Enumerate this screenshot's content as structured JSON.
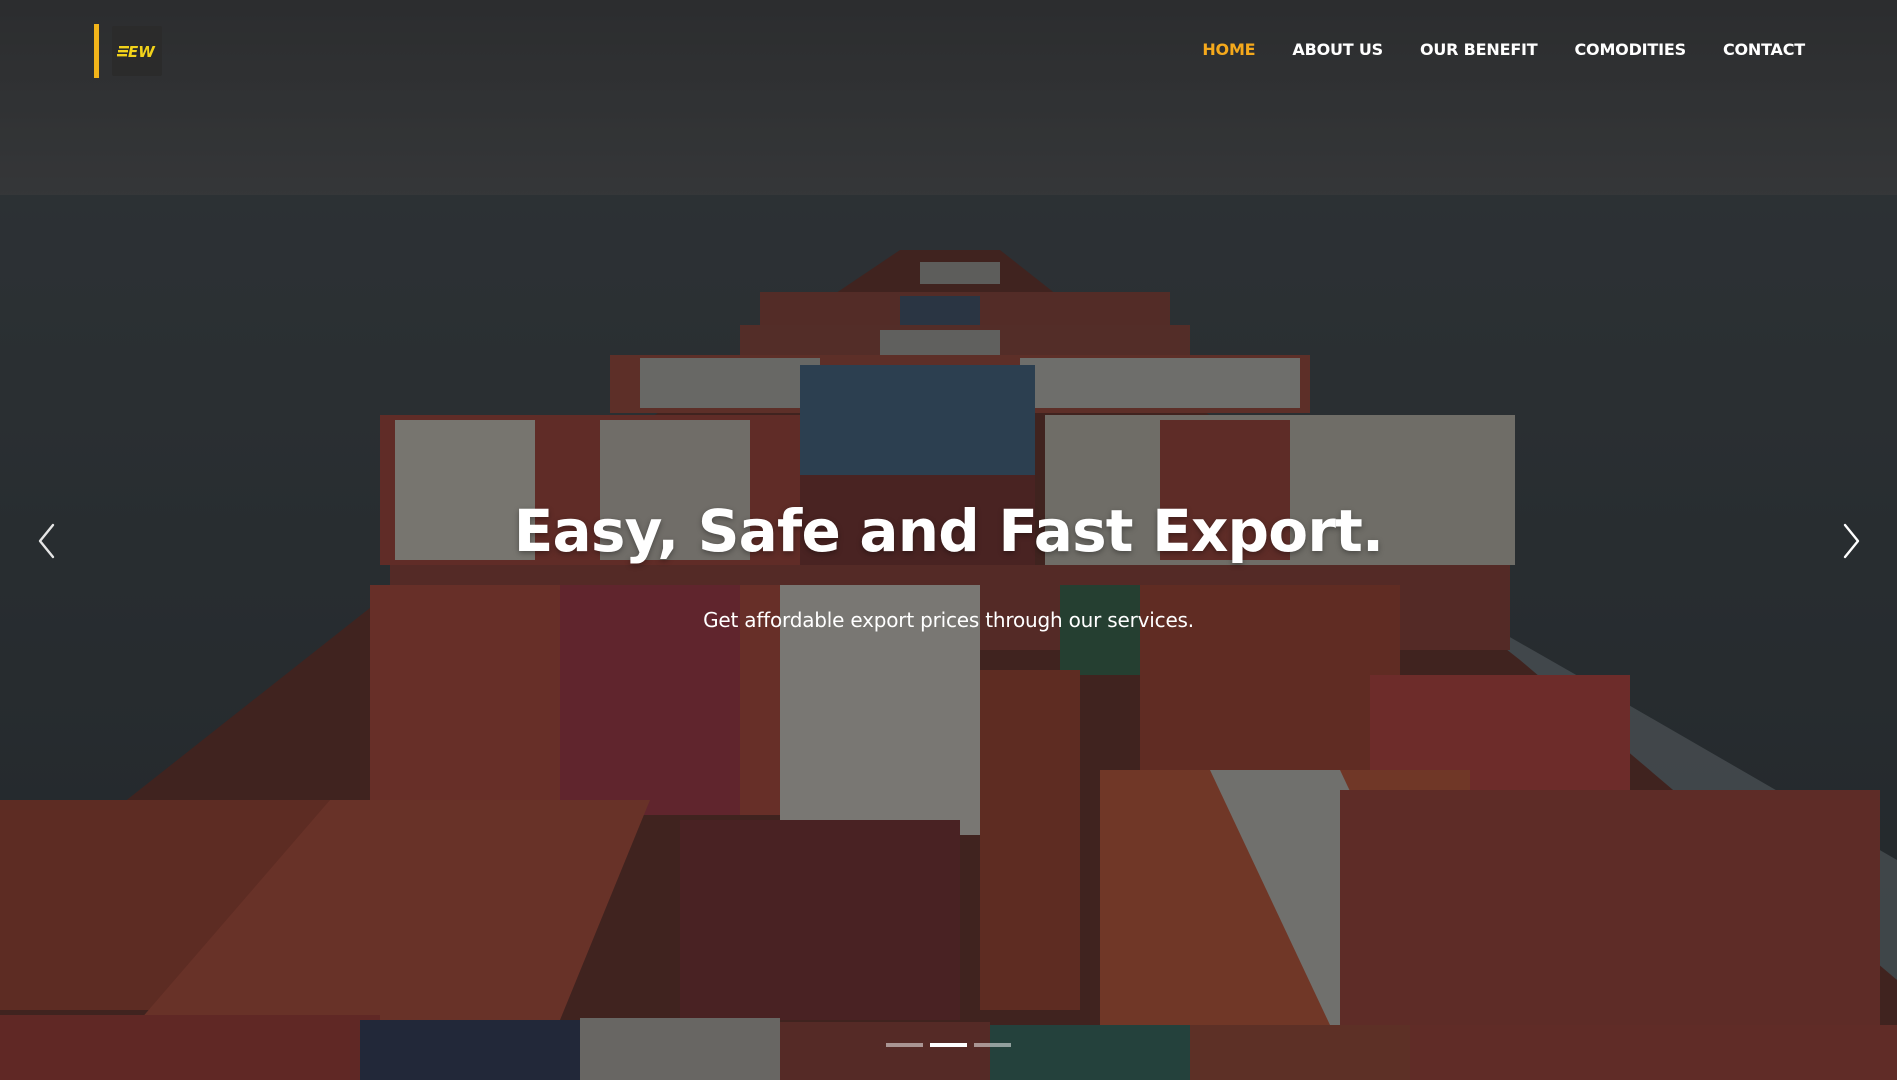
{
  "brand": {
    "logo_text": "EW",
    "accent_color": "#f2b41a"
  },
  "nav": {
    "items": [
      {
        "label": "HOME",
        "active": true
      },
      {
        "label": "ABOUT US",
        "active": false
      },
      {
        "label": "OUR BENEFIT",
        "active": false
      },
      {
        "label": "COMODITIES",
        "active": false
      },
      {
        "label": "CONTACT",
        "active": false
      }
    ],
    "active_color": "#f5a91c"
  },
  "hero": {
    "title": "Easy, Safe and Fast Export.",
    "subtitle": "Get affordable export prices through our services.",
    "background": "container-ship-image"
  },
  "carousel": {
    "prev_icon": "chevron-left-icon",
    "next_icon": "chevron-right-icon",
    "slide_count": 3,
    "active_slide": 2
  }
}
